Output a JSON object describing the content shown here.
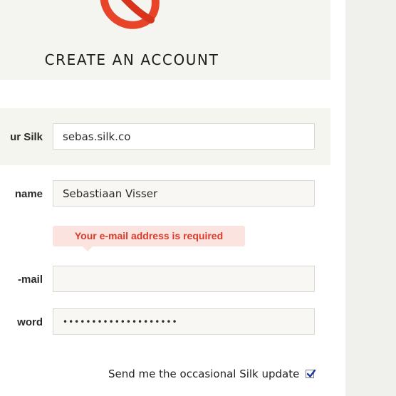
{
  "header": {
    "title": "CREATE AN ACCOUNT"
  },
  "form": {
    "silk_label": "ur Silk",
    "silk_value": "sebas.silk.co",
    "name_label": "name",
    "name_value": "Sebastiaan Visser",
    "email_error": "Your e-mail address is required",
    "email_label": "-mail",
    "email_value": "",
    "password_label": "word",
    "password_value": "••••••••••••••••••••",
    "updates_label": "Send me the occasional Silk update",
    "updates_checked": true
  },
  "colors": {
    "brand": "#e8442a",
    "error": "#d93b2b",
    "check": "#1a3a9e"
  }
}
